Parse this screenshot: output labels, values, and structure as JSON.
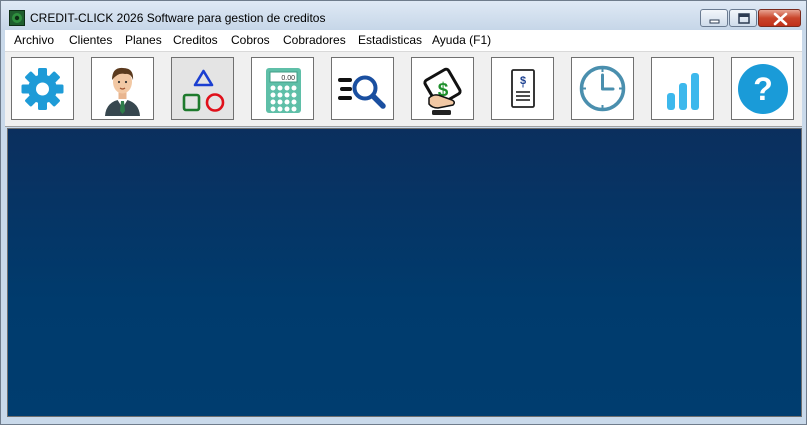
{
  "window": {
    "title": "CREDIT-CLICK 2026 Software para gestion de creditos",
    "controls": [
      "minimize",
      "maximize",
      "close"
    ]
  },
  "menu": {
    "items": [
      "Archivo",
      "Clientes",
      "Planes",
      "Creditos",
      "Cobros",
      "Cobradores",
      "Estadisticas",
      "Ayuda (F1)"
    ]
  },
  "toolbar": {
    "buttons": [
      {
        "icon": "gear-icon"
      },
      {
        "icon": "person-icon"
      },
      {
        "icon": "shapes-icon"
      },
      {
        "icon": "calculator-icon",
        "display": "0.00"
      },
      {
        "icon": "search-list-icon"
      },
      {
        "icon": "money-hand-icon",
        "symbol": "$"
      },
      {
        "icon": "invoice-icon",
        "symbol": "$"
      },
      {
        "icon": "clock-icon"
      },
      {
        "icon": "bar-chart-icon"
      },
      {
        "icon": "help-icon",
        "symbol": "?"
      }
    ]
  },
  "colors": {
    "workspace": "#003d6f",
    "gear": "#1e9bd7",
    "calculator": "#5fbfa8",
    "chart": "#3db8ec",
    "help": "#1a9bd8"
  }
}
